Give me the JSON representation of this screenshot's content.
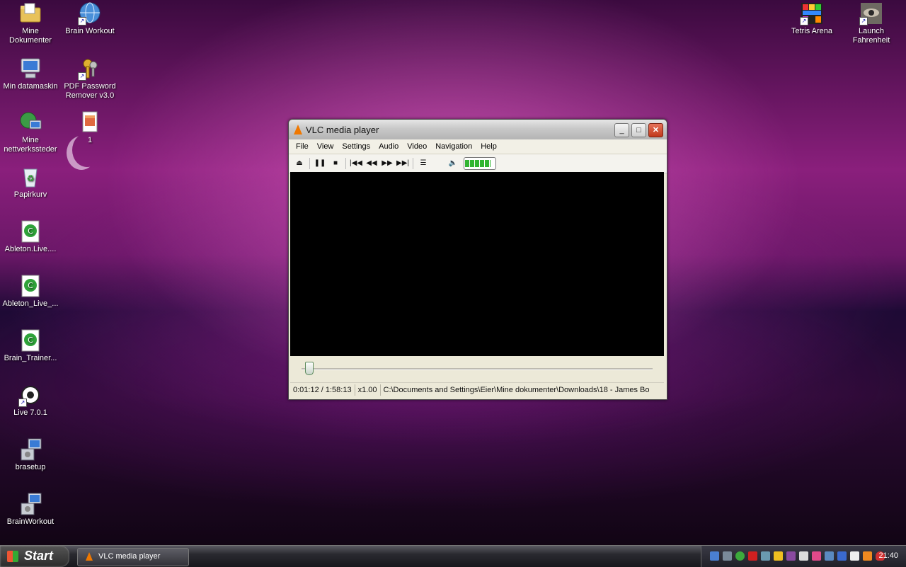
{
  "desktop": {
    "icons": [
      {
        "label": "Mine\nDokumenter",
        "icon": "folder-icon"
      },
      {
        "label": "Brain Workout",
        "icon": "globe-icon"
      },
      {
        "label": "Min datamaskin",
        "icon": "computer-icon"
      },
      {
        "label": "PDF Password\nRemover v3.0",
        "icon": "keys-icon"
      },
      {
        "label": "Mine\nnettverkssteder",
        "icon": "network-icon"
      },
      {
        "label": "1",
        "icon": "archive-icon"
      },
      {
        "label": "Papirkurv",
        "icon": "recycle-bin-icon"
      },
      {
        "label": "Ableton.Live....",
        "icon": "torrent-file-icon"
      },
      {
        "label": "Ableton_Live_...",
        "icon": "torrent-file-icon"
      },
      {
        "label": "Brain_Trainer...",
        "icon": "torrent-file-icon"
      },
      {
        "label": "Live 7.0.1",
        "icon": "live-app-icon"
      },
      {
        "label": "brasetup",
        "icon": "installer-icon"
      },
      {
        "label": "BrainWorkout",
        "icon": "installer-icon"
      },
      {
        "label": "Tetris Arena",
        "icon": "tetris-icon"
      },
      {
        "label": "Launch\nFahrenheit",
        "icon": "fahrenheit-icon"
      }
    ]
  },
  "vlc": {
    "title": "VLC media player",
    "menu": [
      "File",
      "View",
      "Settings",
      "Audio",
      "Video",
      "Navigation",
      "Help"
    ],
    "volume_level": 0.85,
    "seek_position": 0.01,
    "status": {
      "time": "0:01:12 / 1:58:13",
      "speed": "x1.00",
      "path": "C:\\Documents and Settings\\Eier\\Mine dokumenter\\Downloads\\18 - James Bo"
    }
  },
  "taskbar": {
    "start_label": "Start",
    "task_label": "VLC media player",
    "clock": "21:40"
  }
}
